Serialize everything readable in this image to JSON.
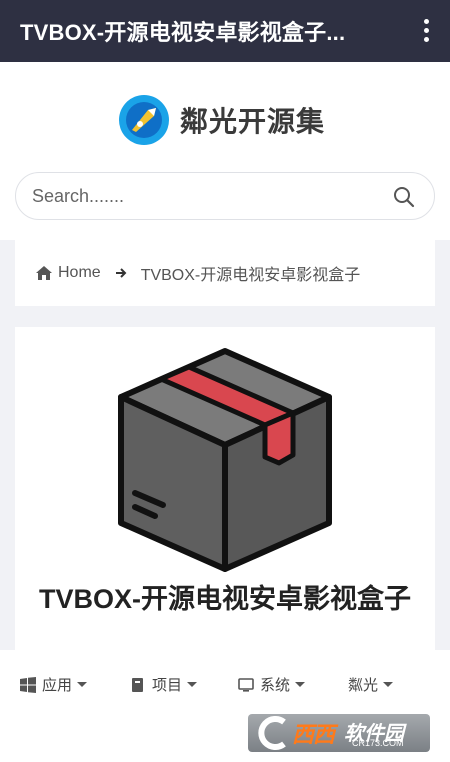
{
  "appbar": {
    "title": "TVBOX-开源电视安卓影视盒子..."
  },
  "site": {
    "name": "鄰光开源集"
  },
  "search": {
    "placeholder": "Search......."
  },
  "breadcrumb": {
    "home": "Home",
    "current": "TVBOX-开源电视安卓影视盒子"
  },
  "post": {
    "title": "TVBOX-开源电视安卓影视盒子"
  },
  "bottom_nav": [
    {
      "label": "应用",
      "icon": "windows-icon"
    },
    {
      "label": "项目",
      "icon": "book-icon"
    },
    {
      "label": "系统",
      "icon": "monitor-icon"
    },
    {
      "label": "粼光",
      "icon": ""
    }
  ],
  "watermark": {
    "brand": "西西",
    "suffix": "软件园",
    "url": "CR173.COM"
  },
  "colors": {
    "appbar": "#2e3042",
    "box_body": "#5f5f5f",
    "box_tape": "#d9474f"
  }
}
